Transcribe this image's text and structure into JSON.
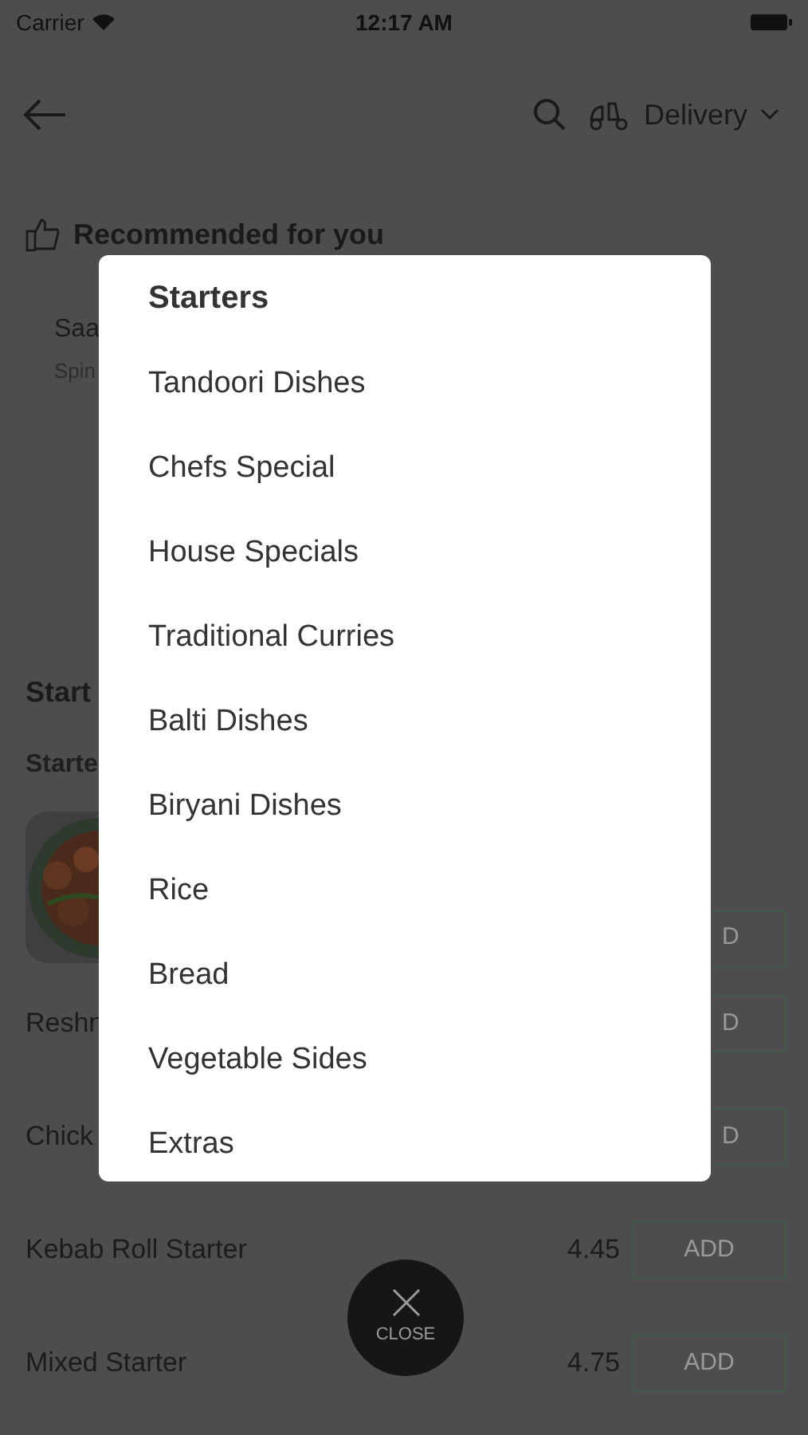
{
  "status_bar": {
    "carrier": "Carrier",
    "time": "12:17 AM"
  },
  "header": {
    "order_mode": "Delivery"
  },
  "recommended": {
    "title": "Recommended for you",
    "item_name": "Saa",
    "item_desc": "Spin"
  },
  "section": {
    "title": "Start",
    "subtitle": "Starte"
  },
  "menu_items": [
    {
      "kind": "picture_row",
      "add_label": "D"
    },
    {
      "kind": "partial",
      "name": "Reshn",
      "add_label": "D"
    },
    {
      "kind": "partial",
      "name": "Chick",
      "add_label": "D"
    },
    {
      "kind": "full",
      "name": "Kebab Roll Starter",
      "price": "4.45",
      "add_label": "ADD"
    },
    {
      "kind": "full",
      "name": "Mixed Starter",
      "price": "4.75",
      "add_label": "ADD"
    }
  ],
  "category_menu": {
    "title": "Starters",
    "items": [
      "Tandoori Dishes",
      "Chefs Special",
      "House Specials",
      "Traditional Curries",
      "Balti Dishes",
      "Biryani Dishes",
      "Rice",
      "Bread",
      "Vegetable Sides",
      "Extras"
    ]
  },
  "close_button": {
    "label": "CLOSE"
  }
}
